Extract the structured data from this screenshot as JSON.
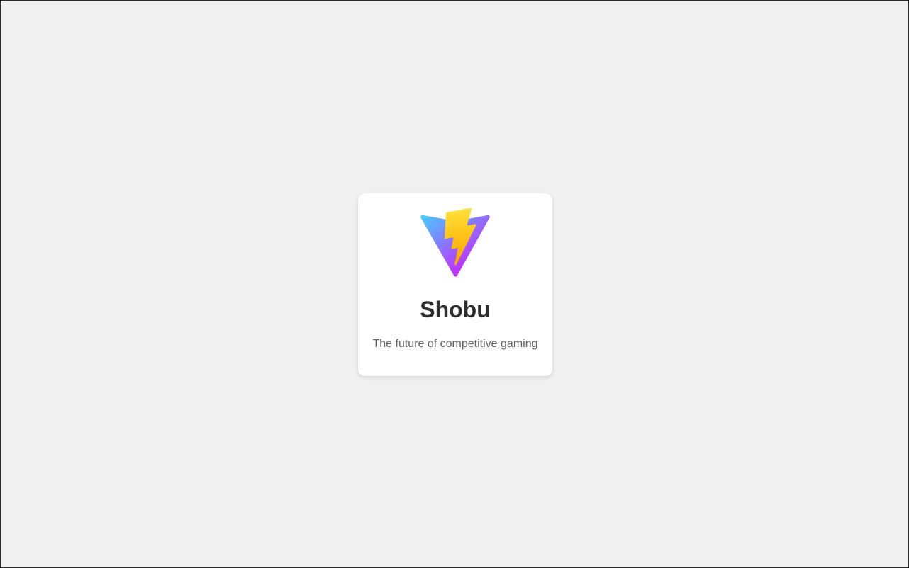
{
  "page": {
    "background": "#f0f0f0"
  },
  "card": {
    "logo_icon": "vite-logo-icon",
    "title": "Shobu",
    "tagline": "The future of competitive gaming"
  },
  "colors": {
    "card_background": "#ffffff",
    "title_text": "#2e2e2e",
    "tagline_text": "#606060",
    "logo_gradient_start": "#41d1ff",
    "logo_gradient_end": "#bd34fe",
    "bolt_gradient_start": "#ffea83",
    "bolt_gradient_end": "#ffa800"
  }
}
